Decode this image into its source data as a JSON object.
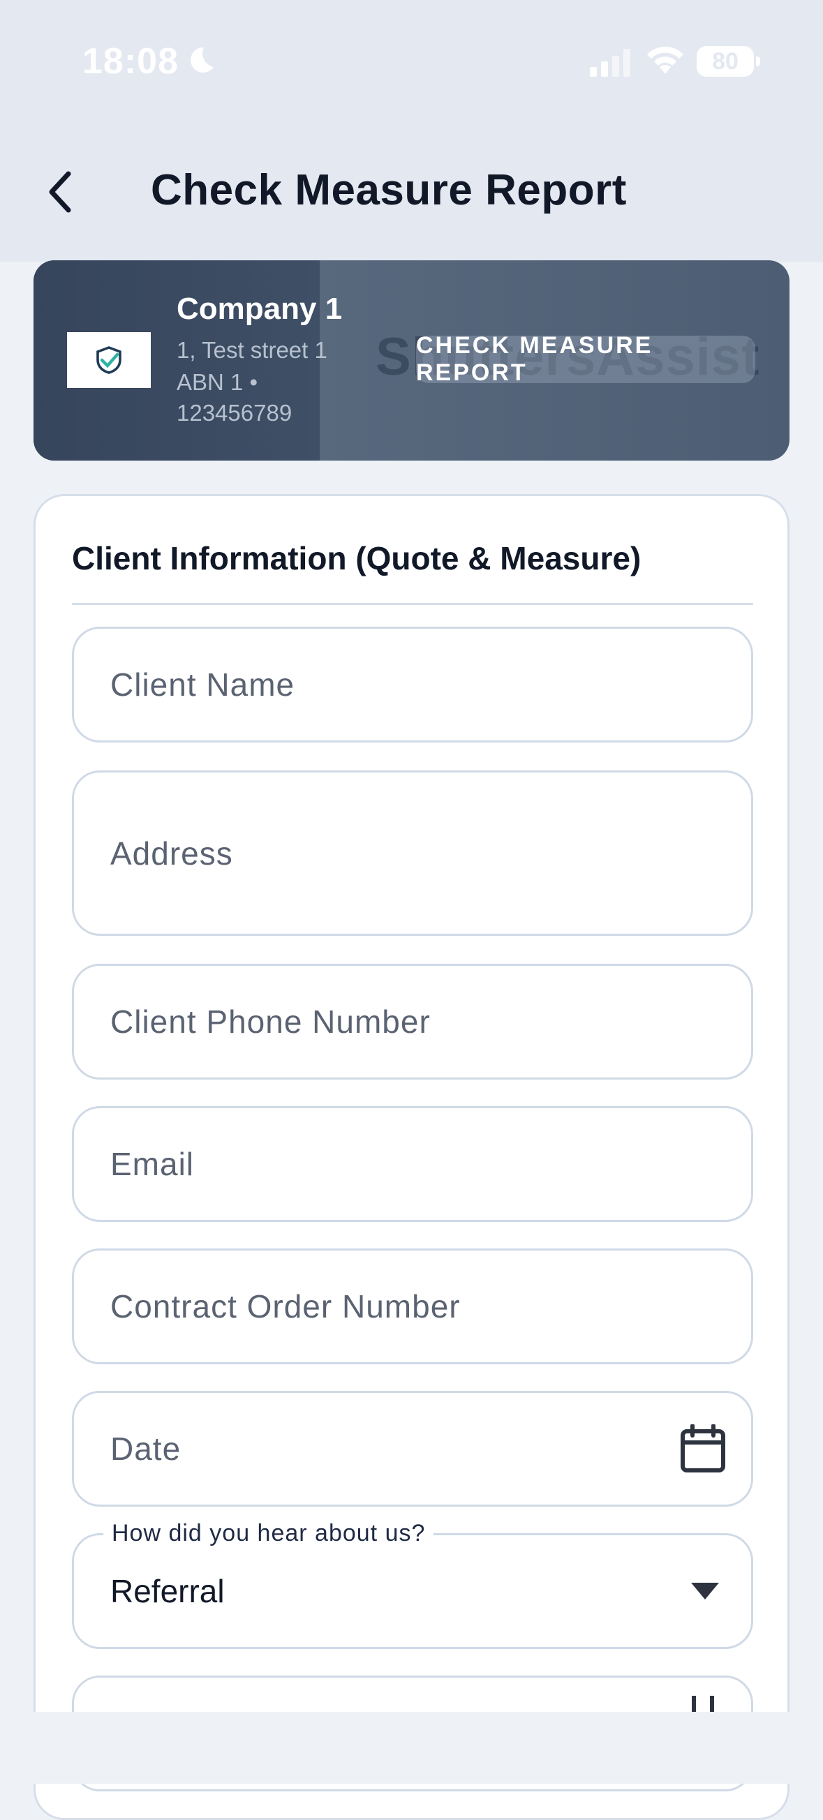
{
  "status": {
    "time": "18:08",
    "battery": "80"
  },
  "nav": {
    "title": "Check Measure Report"
  },
  "company": {
    "name": "Company 1",
    "address": "1, Test street 1",
    "abn": "ABN 1  •",
    "abn_number": "123456789",
    "watermark": "ShuttersAssist",
    "badge": "CHECK MEASURE REPORT"
  },
  "form": {
    "section_title": "Client Information (Quote & Measure)",
    "fields": {
      "client_name": "Client Name",
      "address": "Address",
      "client_phone": "Client Phone Number",
      "email": "Email",
      "contract_order": "Contract Order Number",
      "date": "Date"
    },
    "referral": {
      "label": "How did you hear about us?",
      "value": "Referral"
    }
  },
  "colors": {
    "header_bg": "#e4e8f1",
    "card_bg": "#4d5d73",
    "text_primary": "#111827"
  }
}
